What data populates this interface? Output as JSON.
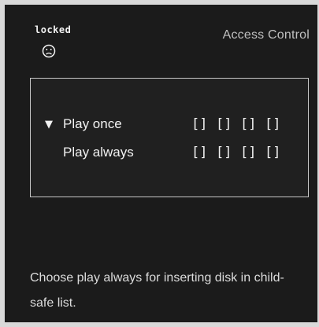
{
  "screen": {
    "status_label": "locked",
    "status_icon": "sad-face-icon",
    "title": "Access Control"
  },
  "options": [
    {
      "label": "Play once",
      "selected": true,
      "slots": [
        "[]",
        "[]",
        "[]",
        "[]"
      ]
    },
    {
      "label": "Play always",
      "selected": false,
      "slots": [
        "[]",
        "[]",
        "[]",
        "[]"
      ]
    }
  ],
  "help_text": "Choose play always for inserting disk in child-safe list.",
  "colors": {
    "background": "#1b1b1b",
    "text": "#f2f2f2",
    "title": "#bfbfbf",
    "panel_border": "#c8c8c8"
  }
}
